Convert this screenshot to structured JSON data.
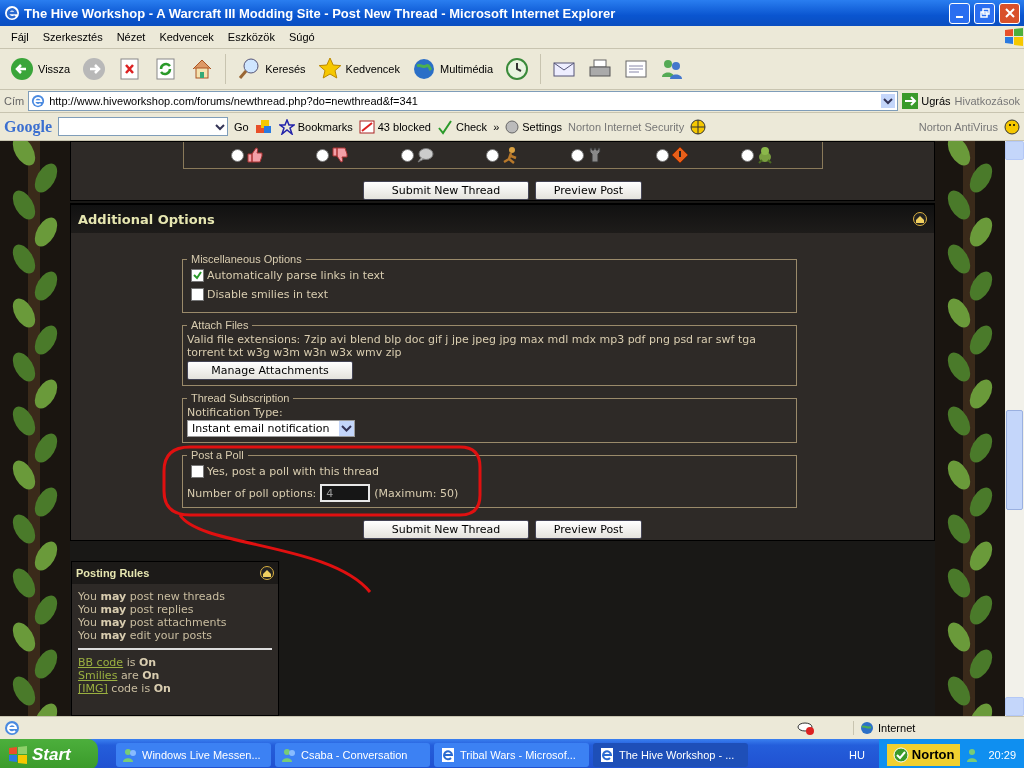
{
  "window": {
    "title": "The Hive Workshop - A Warcraft III Modding Site - Post New Thread - Microsoft Internet Explorer"
  },
  "menu": [
    "Fájl",
    "Szerkesztés",
    "Nézet",
    "Kedvencek",
    "Eszközök",
    "Súgó"
  ],
  "toolbar": [
    {
      "kind": "back",
      "label": "Vissza"
    },
    {
      "kind": "forward"
    },
    {
      "kind": "stop"
    },
    {
      "kind": "refresh"
    },
    {
      "kind": "home"
    },
    {
      "kind": "search",
      "label": "Keresés"
    },
    {
      "kind": "favorites",
      "label": "Kedvencek"
    },
    {
      "kind": "media",
      "label": "Multimédia"
    },
    {
      "kind": "history"
    },
    {
      "kind": "mail"
    },
    {
      "kind": "print"
    },
    {
      "kind": "edit"
    },
    {
      "kind": "messenger"
    }
  ],
  "address_bar": {
    "label": "Cím",
    "value": "http://www.hiveworkshop.com/forums/newthread.php?do=newthread&f=341",
    "go": "Ugrás",
    "links": "Hivatkozások"
  },
  "google_toolbar": {
    "logo": "Google",
    "go": "Go",
    "bookmarks": "Bookmarks",
    "blocked": "43 blocked",
    "check": "Check",
    "more": "»",
    "settings": "Settings",
    "norton_security": "Norton Internet Security",
    "norton_antivirus": "Norton AntiVirus"
  },
  "post_icons": [
    {
      "kind": "thumbs-up",
      "selected": false
    },
    {
      "kind": "thumbs-down",
      "selected": false
    },
    {
      "kind": "speech",
      "selected": false
    },
    {
      "kind": "figure",
      "selected": false
    },
    {
      "kind": "tower",
      "selected": false
    },
    {
      "kind": "warning",
      "selected": false
    },
    {
      "kind": "creature",
      "selected": false
    }
  ],
  "top_buttons": [
    "Submit New Thread",
    "Preview Post"
  ],
  "additional_options": {
    "title": "Additional Options",
    "misc": {
      "legend": "Miscellaneous Options",
      "options": [
        {
          "label": "Automatically parse links in text",
          "checked": true
        },
        {
          "label": "Disable smilies in text",
          "checked": false
        }
      ]
    },
    "attach": {
      "legend": "Attach Files",
      "text": "Valid file extensions: 7zip avi blend blp doc gif j jpe jpeg jpg max mdl mdx mp3 pdf png psd rar swf tga torrent txt w3g w3m w3n w3x wmv zip",
      "button": "Manage Attachments"
    },
    "subscription": {
      "legend": "Thread Subscription",
      "label": "Notification Type:",
      "select": "Instant email notification"
    },
    "poll": {
      "legend": "Post a Poll",
      "checkbox": {
        "label": "Yes, post a poll with this thread",
        "checked": false
      },
      "count_label": "Number of poll options:",
      "count_value": "4",
      "maximum": "(Maximum: 50)"
    },
    "buttons": [
      "Submit New Thread",
      "Preview Post"
    ]
  },
  "posting_rules": {
    "title": "Posting Rules",
    "rules": [
      "You **may** post new threads",
      "You **may** post replies",
      "You **may** post attachments",
      "You **may** edit your posts"
    ],
    "settings": [
      {
        "link": "BB code",
        "text": "is",
        "value": "On"
      },
      {
        "link": "Smilies",
        "text": "are",
        "value": "On"
      },
      {
        "link": "[IMG]",
        "text": "code is",
        "value": "On"
      }
    ]
  },
  "status_bar": {
    "zone": "Internet"
  },
  "taskbar": {
    "start": "Start",
    "tasks": [
      {
        "label": "Windows Live Messen...",
        "kind": "messenger",
        "selected": false
      },
      {
        "label": "Csaba - Conversation",
        "kind": "messenger",
        "selected": false
      },
      {
        "label": "Tribal Wars - Microsof...",
        "kind": "browser",
        "selected": false
      },
      {
        "label": "The Hive Workshop - ...",
        "kind": "browser",
        "selected": true
      }
    ],
    "language": "HU",
    "norton": "Norton",
    "clock": "20:29"
  }
}
